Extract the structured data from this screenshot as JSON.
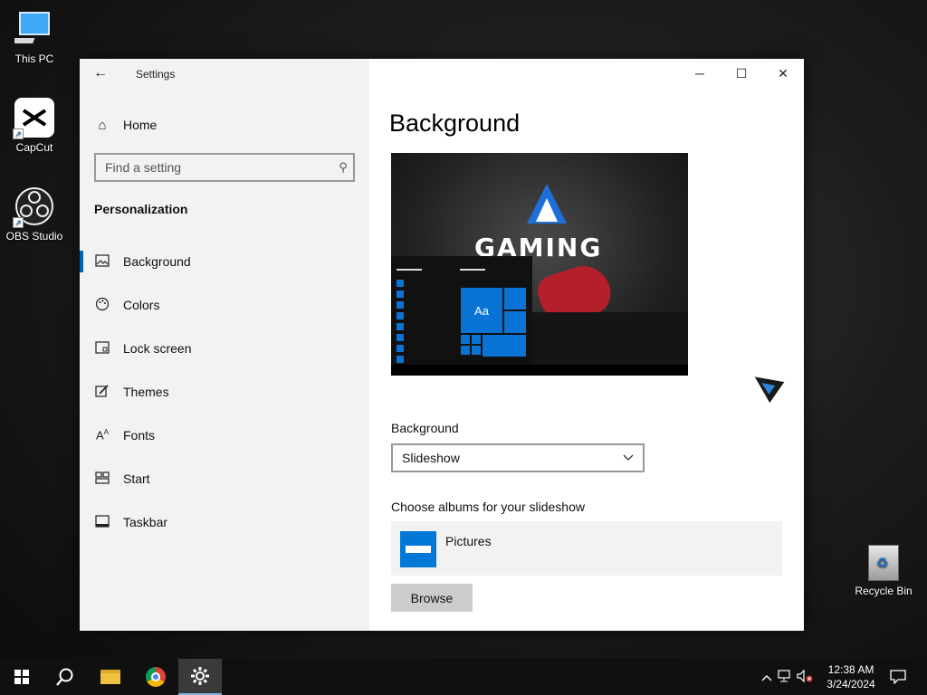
{
  "desktop": {
    "icons": [
      {
        "label": "This PC"
      },
      {
        "label": "CapCut"
      },
      {
        "label": "OBS Studio"
      }
    ],
    "recycle_bin": "Recycle Bin"
  },
  "window": {
    "title": "Settings",
    "controls": {
      "minimize": "─",
      "maximize": "☐",
      "close": "✕"
    }
  },
  "sidebar": {
    "home": "Home",
    "search_placeholder": "Find a setting",
    "section": "Personalization",
    "items": [
      {
        "label": "Background",
        "icon": "image-icon",
        "glyph": "🖼"
      },
      {
        "label": "Colors",
        "icon": "palette-icon",
        "glyph": "🎨"
      },
      {
        "label": "Lock screen",
        "icon": "lock-screen-icon",
        "glyph": "▭"
      },
      {
        "label": "Themes",
        "icon": "brush-icon",
        "glyph": "✎"
      },
      {
        "label": "Fonts",
        "icon": "font-icon",
        "glyph": "A"
      },
      {
        "label": "Start",
        "icon": "start-icon",
        "glyph": "▦"
      },
      {
        "label": "Taskbar",
        "icon": "taskbar-icon",
        "glyph": "▭"
      }
    ],
    "active_index": 0
  },
  "main": {
    "title": "Background",
    "preview": {
      "brand_text": "GAMING",
      "tile_label": "Aa"
    },
    "background_label": "Background",
    "background_value": "Slideshow",
    "albums_label": "Choose albums for your slideshow",
    "album_name": "Pictures",
    "browse_label": "Browse"
  },
  "taskbar": {
    "time": "12:38 AM",
    "date": "3/24/2024"
  },
  "colors": {
    "accent": "#0078d7",
    "sidebar_bg": "#f2f2f2"
  }
}
